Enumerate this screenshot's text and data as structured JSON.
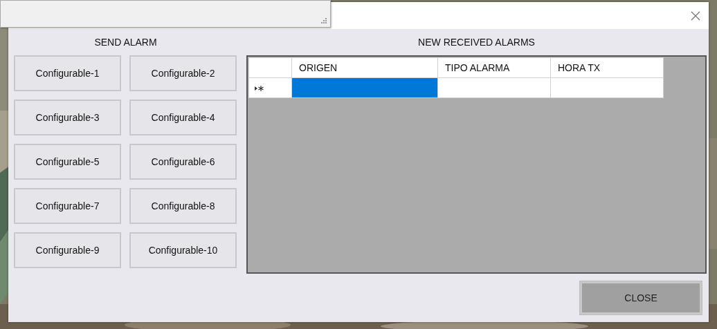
{
  "dialog": {
    "send_title": "SEND ALARM",
    "received_title": "NEW RECEIVED ALARMS",
    "send_buttons": [
      "Configurable-1",
      "Configurable-2",
      "Configurable-3",
      "Configurable-4",
      "Configurable-5",
      "Configurable-6",
      "Configurable-7",
      "Configurable-8",
      "Configurable-9",
      "Configurable-10"
    ],
    "grid": {
      "columns": [
        "ORIGEN",
        "TIPO ALARMA",
        "HORA TX"
      ],
      "rows": [
        {
          "new_row": true,
          "cells": [
            {
              "selected": true
            },
            {
              "selected": false
            },
            {
              "selected": false
            }
          ]
        }
      ]
    },
    "close_button": "CLOSE"
  }
}
